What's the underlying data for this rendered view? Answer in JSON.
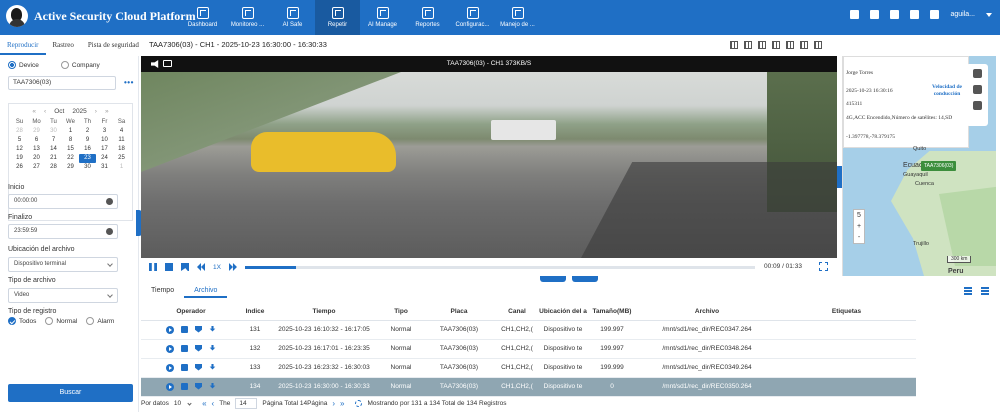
{
  "app": {
    "title": "Active Security Cloud Platform"
  },
  "nav": [
    {
      "label": "Dashboard",
      "icon": "dashboard-icon"
    },
    {
      "label": "Monitoreo ...",
      "icon": "map-pin-icon"
    },
    {
      "label": "AI Safe",
      "icon": "shield-icon"
    },
    {
      "label": "Repetir",
      "icon": "replay-icon"
    },
    {
      "label": "AI Manage",
      "icon": "ai-manage-icon"
    },
    {
      "label": "Reportes",
      "icon": "report-icon"
    },
    {
      "label": "Configurac...",
      "icon": "settings-icon"
    },
    {
      "label": "Manejo de ...",
      "icon": "manage-icon"
    }
  ],
  "user": {
    "name": "aguila..."
  },
  "subtabs": [
    "Reproducir",
    "Rastreo",
    "Pista de seguridad"
  ],
  "video": {
    "title": "TAA7306(03) - CH1 - 2025-10-23 16:30:00 - 16:30:33",
    "overlay": "TAA7306(03) - CH1 373KB/S",
    "speed": "1X",
    "time": "00:09 / 01:33",
    "progress_fraction": 0.1
  },
  "left": {
    "radio_device": "Device",
    "radio_company": "Company",
    "device_value": "TAA7306(03)",
    "calendar": {
      "month": "Oct",
      "year": "2025",
      "dow": [
        "Su",
        "Mo",
        "Tu",
        "We",
        "Th",
        "Fr",
        "Sa"
      ],
      "days": [
        "28",
        "29",
        "30",
        "1",
        "2",
        "3",
        "4",
        "5",
        "6",
        "7",
        "8",
        "9",
        "10",
        "11",
        "12",
        "13",
        "14",
        "15",
        "16",
        "17",
        "18",
        "19",
        "20",
        "21",
        "22",
        "23",
        "24",
        "25",
        "26",
        "27",
        "28",
        "29",
        "30",
        "31",
        "1"
      ],
      "selected": "23"
    },
    "start_label": "Inicio",
    "start_value": "00:00:00",
    "end_label": "Finalizo",
    "end_value": "23:59:59",
    "location_label": "Ubicación del archivo",
    "location_value": "Dispositivo terminal",
    "type_label": "Tipo de archivo",
    "type_value": "Video",
    "reg_label": "Tipo de registro",
    "reg_all": "Todos",
    "reg_normal": "Normal",
    "reg_alarm": "Alarm",
    "search_label": "Buscar"
  },
  "map": {
    "driver": "Jorge Torres",
    "time": "2025-10-23 16:30:16",
    "code": "415311",
    "status": "4G,ACC Encendido,Número de satélites: 14,SD",
    "coords": "-1.397778,-78.379175",
    "speed_label": "Velocidad de conducción",
    "vehicle_label": "TAA7306(03)",
    "cities": [
      "Quito",
      "Ecuador",
      "Guayaquil",
      "Cuenca",
      "Trujillo"
    ],
    "country": "Peru",
    "scale": "300 km",
    "zoom_level": "5",
    "zoom_in": "+",
    "zoom_out": "-"
  },
  "bottom": {
    "tabs": [
      "Tiempo",
      "Archivo"
    ],
    "columns": [
      "Operador",
      "Indice",
      "Tiempo",
      "Tipo",
      "Placa",
      "Canal",
      "Ubicación del a",
      "Tamaño(MB)",
      "Archivo",
      "Etiquetas"
    ],
    "rows": [
      {
        "indice": "131",
        "tiempo": "2025-10-23 16:10:32 - 16:17:05",
        "tipo": "Normal",
        "placa": "TAA7306(03)",
        "canal": "CH1,CH2,(",
        "ubicacion": "Dispositivo te",
        "tamano": "199.997",
        "archivo": "/mnt/sd1/rec_dir/REC0347.264",
        "etiquetas": ""
      },
      {
        "indice": "132",
        "tiempo": "2025-10-23 16:17:01 - 16:23:35",
        "tipo": "Normal",
        "placa": "TAA7306(03)",
        "canal": "CH1,CH2,(",
        "ubicacion": "Dispositivo te",
        "tamano": "199.997",
        "archivo": "/mnt/sd1/rec_dir/REC0348.264",
        "etiquetas": ""
      },
      {
        "indice": "133",
        "tiempo": "2025-10-23 16:23:32 - 16:30:03",
        "tipo": "Normal",
        "placa": "TAA7306(03)",
        "canal": "CH1,CH2,(",
        "ubicacion": "Dispositivo te",
        "tamano": "199.999",
        "archivo": "/mnt/sd1/rec_dir/REC0349.264",
        "etiquetas": ""
      },
      {
        "indice": "134",
        "tiempo": "2025-10-23 16:30:00 - 16:30:33",
        "tipo": "Normal",
        "placa": "TAA7306(03)",
        "canal": "CH1,CH2,(",
        "ubicacion": "Dispositivo te",
        "tamano": "0",
        "archivo": "/mnt/sd1/rec_dir/REC0350.264",
        "etiquetas": ""
      }
    ],
    "pager": {
      "per_page_label": "Por datos",
      "per_page": "10",
      "the_label": "The",
      "page": "14",
      "page_total": "Página Total 14Página",
      "showing": "Mostrando por 131 a 134 Total de 134 Registros"
    }
  }
}
